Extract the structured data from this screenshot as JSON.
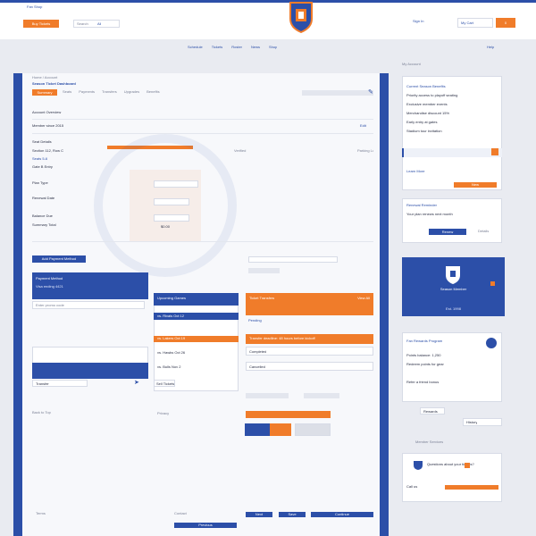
{
  "header": {
    "top_link": "Fan Shop",
    "cta_button": "Buy Tickets",
    "search_placeholder": "Search",
    "search_scope": "All",
    "account_link": "Sign In",
    "cart_link": "My Cart",
    "cart_count": "0",
    "nav": [
      "Schedule",
      "Tickets",
      "Roster",
      "News",
      "Shop"
    ],
    "nav_right": "Help"
  },
  "main": {
    "breadcrumb": "Home / Account",
    "title": "Season Ticket Dashboard",
    "tab_active": "Summary",
    "tabs": [
      "Seats",
      "Payments",
      "Transfers",
      "Upgrades",
      "Benefits"
    ],
    "section1_title": "Account Overview",
    "account_row_label": "Member since 2015",
    "account_row_value": "Edit",
    "details_title": "Seat Details",
    "details_rows": [
      "Section 112, Row C",
      "Seats 5-6",
      "Gate B Entry",
      "Parking Lot 3"
    ],
    "detail_value": "Verified",
    "form_fields": [
      "Plan Type",
      "Renewal Date",
      "Balance Due"
    ],
    "summary_label": "Summary Total",
    "summary_value": "$0.00",
    "add_button": "Add Payment Method",
    "select_value": "Card on file",
    "blue_card_title": "Payment Method",
    "blue_card_sub": "Visa ending 4421",
    "input_placeholder": "Enter promo code",
    "mid_card_header": "Upcoming Games",
    "mid_card_rows": [
      "vs. Rivals  Oct 12",
      "vs. Lakers  Oct 19",
      "vs. Hawks  Oct 26",
      "vs. Bulls  Nov 2"
    ],
    "orange_card_header": "Ticket Transfers",
    "orange_card_link": "View All",
    "orange_rows": [
      "Pending",
      "Completed",
      "Cancelled"
    ],
    "orange_strip": "Transfer deadline: 48 hours before kickoff",
    "bottom_links": [
      "Back to Top",
      "Privacy",
      "Terms",
      "Contact"
    ],
    "action_button_1": "Transfer",
    "action_button_2": "Sell Tickets",
    "footer_buttons": [
      "Previous",
      "Next",
      "Save",
      "Continue"
    ]
  },
  "sidebar": {
    "label": "My Account",
    "widget1_title": "Current Season Benefits",
    "widget1_items": [
      "Priority access to playoff seating",
      "Exclusive member events",
      "Merchandise discount 15%",
      "Early entry at gates",
      "Stadium tour invitation"
    ],
    "widget1_link": "Learn More",
    "widget1_badge": "New",
    "widget2_title": "Renewal Reminder",
    "widget2_text": "Your plan renews next month",
    "widget2_button": "Renew",
    "widget2_link": "Details",
    "crest_text": "Season Member",
    "crest_sub": "Est. 1998",
    "widget3_title": "Fan Rewards Program",
    "widget3_items": [
      "Points balance: 1,250",
      "Redeem points for gear",
      "Refer a friend bonus"
    ],
    "widget3_button": "Rewards",
    "widget3_link": "History",
    "widget4_title": "Member Services",
    "widget4_text": "Questions about your tickets?",
    "widget4_link": "Call us"
  },
  "colors": {
    "brand_blue": "#2c4fa8",
    "accent_orange": "#f07c2a",
    "page_bg": "#e9ebf1"
  }
}
